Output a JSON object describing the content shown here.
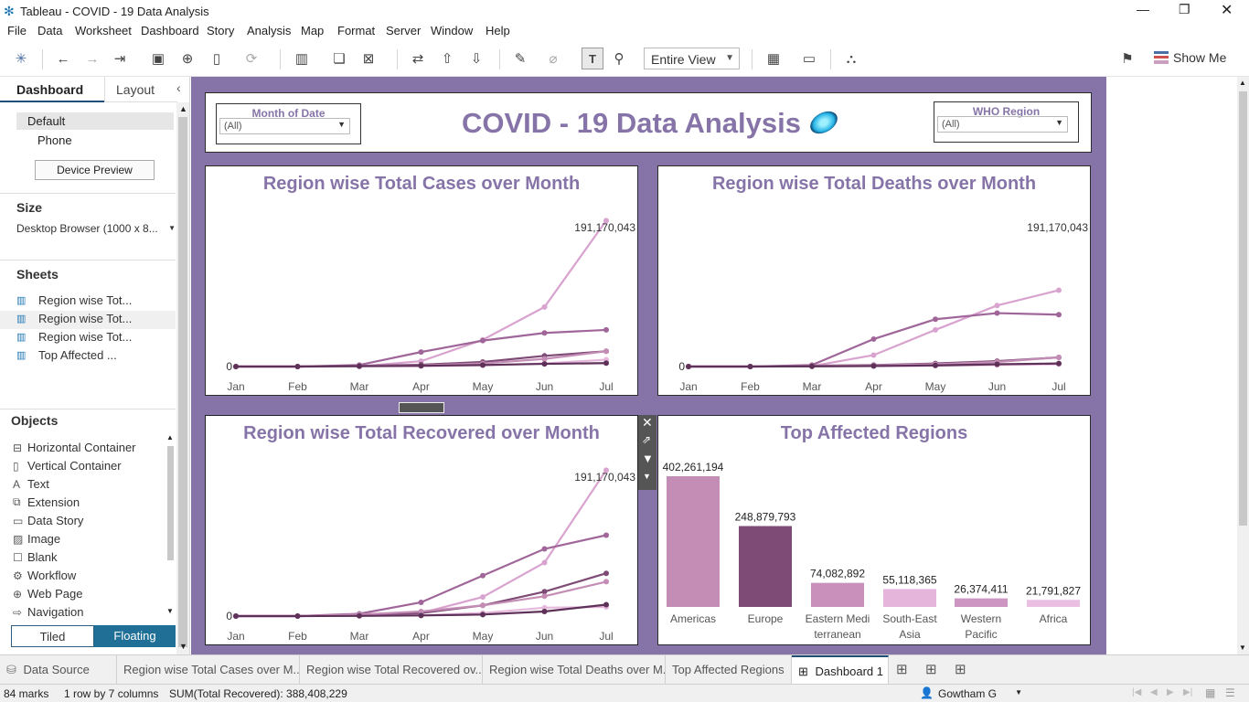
{
  "window": {
    "title": "Tableau - COVID - 19 Data Analysis"
  },
  "menu": [
    "File",
    "Data",
    "Worksheet",
    "Dashboard",
    "Story",
    "Analysis",
    "Map",
    "Format",
    "Server",
    "Window",
    "Help"
  ],
  "toolbar": {
    "view_select": "Entire View",
    "show_me": "Show Me"
  },
  "left": {
    "tab_dashboard": "Dashboard",
    "tab_layout": "Layout",
    "device_default": "Default",
    "device_phone": "Phone",
    "device_preview": "Device Preview",
    "size_header": "Size",
    "size_value": "Desktop Browser (1000 x 8...",
    "sheets_header": "Sheets",
    "sheets": [
      "Region wise Tot...",
      "Region wise Tot...",
      "Region wise Tot...",
      "Top Affected ..."
    ],
    "objects_header": "Objects",
    "objects": [
      {
        "label": "Horizontal Container",
        "icon": "horizontal-container-icon"
      },
      {
        "label": "Vertical Container",
        "icon": "vertical-container-icon"
      },
      {
        "label": "Text",
        "icon": "text-icon"
      },
      {
        "label": "Extension",
        "icon": "extension-icon"
      },
      {
        "label": "Data Story",
        "icon": "data-story-icon"
      },
      {
        "label": "Image",
        "icon": "image-icon"
      },
      {
        "label": "Blank",
        "icon": "blank-icon"
      },
      {
        "label": "Workflow",
        "icon": "workflow-icon"
      },
      {
        "label": "Web Page",
        "icon": "web-page-icon"
      },
      {
        "label": "Navigation",
        "icon": "navigation-icon"
      }
    ],
    "tiled": "Tiled",
    "floating": "Floating"
  },
  "dashboard": {
    "title": "COVID - 19 Data Analysis",
    "filter_month": {
      "label": "Month of Date",
      "value": "(All)"
    },
    "filter_region": {
      "label": "WHO Region",
      "value": "(All)"
    }
  },
  "colors": {
    "canvas": "#8674a8",
    "title": "#8674a8",
    "series": [
      "#d9a3cf",
      "#a0669a",
      "#7e4a76",
      "#c48db5",
      "#e6b8dc",
      "#5e3158"
    ]
  },
  "chart_data": [
    {
      "type": "line",
      "title": "Region wise Total Cases over Month",
      "x": [
        "Jan",
        "Feb",
        "Mar",
        "Apr",
        "May",
        "Jun",
        "Jul"
      ],
      "ylim": [
        0,
        200000000
      ],
      "zero_label": "0",
      "max_label": "191,170,043",
      "series": [
        {
          "values": [
            0,
            0,
            200000,
            7000000,
            35000000,
            78000000,
            191170043
          ]
        },
        {
          "values": [
            0,
            0,
            2000000,
            19000000,
            34000000,
            44000000,
            48000000
          ]
        },
        {
          "values": [
            0,
            0,
            1000000,
            2500000,
            6000000,
            14000000,
            20000000
          ]
        },
        {
          "values": [
            0,
            0,
            800000,
            1500000,
            4000000,
            10000000,
            20000000
          ]
        },
        {
          "values": [
            0,
            0,
            200000,
            500000,
            1500000,
            4000000,
            9000000
          ]
        },
        {
          "values": [
            0,
            0,
            500000,
            1000000,
            2000000,
            3500000,
            4500000
          ]
        }
      ]
    },
    {
      "type": "line",
      "title": "Region wise Total Deaths over Month",
      "x": [
        "Jan",
        "Feb",
        "Mar",
        "Apr",
        "May",
        "Jun",
        "Jul"
      ],
      "ylim": [
        0,
        200000000
      ],
      "zero_label": "0",
      "max_label": "191,170,043",
      "series": [
        {
          "values": [
            0,
            0,
            500000,
            15000000,
            48000000,
            80000000,
            100000000
          ]
        },
        {
          "values": [
            0,
            0,
            2000000,
            36000000,
            62000000,
            70000000,
            68000000
          ]
        },
        {
          "values": [
            0,
            0,
            1000000,
            2000000,
            4000000,
            7000000,
            12000000
          ]
        },
        {
          "values": [
            0,
            0,
            800000,
            1500000,
            3000000,
            6000000,
            12000000
          ]
        },
        {
          "values": [
            0,
            0,
            200000,
            500000,
            1000000,
            2000000,
            3000000
          ]
        },
        {
          "values": [
            0,
            0,
            300000,
            700000,
            1500000,
            3000000,
            4000000
          ]
        }
      ]
    },
    {
      "type": "line",
      "title": "Region wise Total Recovered over Month",
      "x": [
        "Jan",
        "Feb",
        "Mar",
        "Apr",
        "May",
        "Jun",
        "Jul"
      ],
      "ylim": [
        0,
        200000000
      ],
      "zero_label": "0",
      "max_label": "191,170,043",
      "series": [
        {
          "values": [
            0,
            0,
            1000000,
            4000000,
            25000000,
            70000000,
            191170043
          ]
        },
        {
          "values": [
            0,
            0,
            3000000,
            18000000,
            53000000,
            88000000,
            106000000
          ]
        },
        {
          "values": [
            0,
            0,
            1000000,
            4000000,
            14000000,
            32000000,
            56000000
          ]
        },
        {
          "values": [
            0,
            0,
            2000000,
            6000000,
            14000000,
            26000000,
            45000000
          ]
        },
        {
          "values": [
            0,
            0,
            500000,
            1000000,
            4000000,
            11000000,
            12000000
          ]
        },
        {
          "values": [
            0,
            0,
            300000,
            800000,
            2000000,
            6000000,
            15000000
          ]
        }
      ]
    },
    {
      "type": "bar",
      "title": "Top Affected Regions",
      "categories": [
        "Americas",
        "Europe",
        "Eastern Mediterranean",
        "South-East Asia",
        "Western Pacific",
        "Africa"
      ],
      "category_lines": [
        [
          "Americas"
        ],
        [
          "Europe"
        ],
        [
          "Eastern Medi",
          "terranean"
        ],
        [
          "South-East",
          "Asia"
        ],
        [
          "Western",
          "Pacific"
        ],
        [
          "Africa"
        ]
      ],
      "values": [
        402261194,
        248879793,
        74082892,
        55118365,
        26374411,
        21791827
      ],
      "value_labels": [
        "402,261,194",
        "248,879,793",
        "74,082,892",
        "55,118,365",
        "26,374,411",
        "21,791,827"
      ],
      "colors": [
        "#c48db5",
        "#7e4a76",
        "#c990bc",
        "#e5b5db",
        "#cd95c2",
        "#ebbfe2"
      ]
    }
  ],
  "tabs": [
    "Data Source",
    "Region wise Total Cases over M...",
    "Region wise Total Recovered ov...",
    "Region wise Total Deaths over M...",
    "Top Affected Regions",
    "Dashboard 1"
  ],
  "status": {
    "marks": "84 marks",
    "dims": "1 row by 7 columns",
    "sum": "SUM(Total Recovered): 388,408,229",
    "user": "Gowtham G"
  }
}
